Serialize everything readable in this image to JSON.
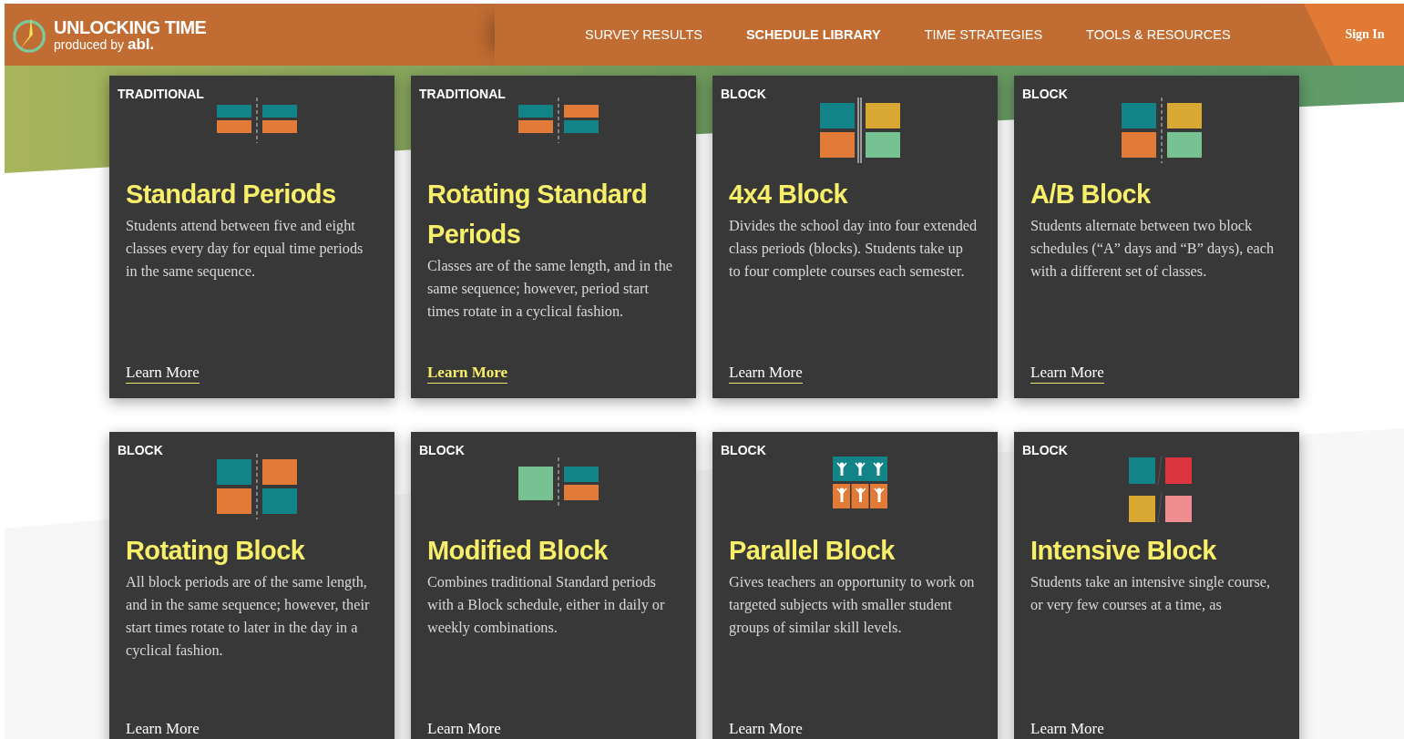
{
  "header": {
    "logo_title": "UNLOCKING TIME",
    "tagline": "produced by **abl.**",
    "nav": [
      {
        "label": "SURVEY RESULTS",
        "selected": false
      },
      {
        "label": "SCHEDULE LIBRARY",
        "selected": true
      },
      {
        "label": "TIME STRATEGIES",
        "selected": false
      },
      {
        "label": "TOOLS & RESOURCES",
        "selected": false
      }
    ],
    "sign_in": "Sign In"
  },
  "cards": [
    {
      "tag": "TRADITIONAL",
      "title": "Standard Periods",
      "description": "Students attend between five and eight classes every day for equal time periods in the same sequence.",
      "link": {
        "label": "Learn More",
        "highlighted": false
      }
    },
    {
      "tag": "TRADITIONAL",
      "title": "Rotating Standard Periods",
      "description": "Classes are of the same length, and in the same sequence; however, period start times rotate in a cyclical fashion.",
      "link": {
        "label": "Learn More",
        "highlighted": true
      }
    },
    {
      "tag": "BLOCK",
      "title": "4x4 Block",
      "description": "Divides the school day into four extended class periods (blocks). Students take up to four complete courses each semester.",
      "link": {
        "label": "Learn More",
        "highlighted": false
      }
    },
    {
      "tag": "BLOCK",
      "title": "A/B Block",
      "description": "Students alternate between two block schedules (“A” days and “B” days), each with a different set of classes.",
      "link": {
        "label": "Learn More",
        "highlighted": false
      }
    },
    {
      "tag": "BLOCK",
      "title": "Rotating Block",
      "description": "All block periods are of the same length, and in the same sequence; however, their start times rotate to later in the day in a cyclical fashion.",
      "link": {
        "label": "Learn More",
        "highlighted": false
      }
    },
    {
      "tag": "BLOCK",
      "title": "Modified Block",
      "description": "Combines traditional Standard periods with a Block schedule, either in daily or weekly combinations.",
      "link": {
        "label": "Learn More",
        "highlighted": false
      }
    },
    {
      "tag": "BLOCK",
      "title": "Parallel Block",
      "description": "Gives teachers an opportunity to work on targeted subjects with smaller student groups of similar skill levels.",
      "link": {
        "label": "Learn More",
        "highlighted": false
      }
    },
    {
      "tag": "BLOCK",
      "title": "Intensive Block",
      "description": "Students take an intensive single course, or very few courses at a time, as",
      "link": {
        "label": "Learn More",
        "highlighted": false
      }
    }
  ]
}
